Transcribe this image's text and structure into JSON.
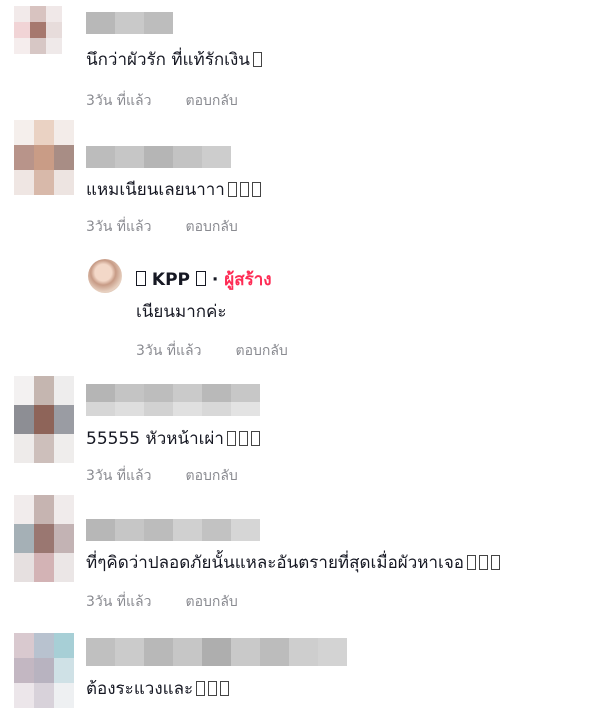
{
  "comments": [
    {
      "text": "นึกว่าผัวรัก ที่แท้รักเงิน",
      "emoji_count": 1,
      "time": "3วัน ที่แล้ว",
      "reply": "ตอบกลับ"
    },
    {
      "text": "แหมเนียนเลยนาาา",
      "emoji_count": 3,
      "time": "3วัน ที่แล้ว",
      "reply": "ตอบกลับ"
    },
    {
      "text": "55555 หัวหน้าเผ่า",
      "emoji_count": 3,
      "time": "3วัน ที่แล้ว",
      "reply": "ตอบกลับ"
    },
    {
      "text": "ที่ๆคิดว่าปลอดภัยนั้นแหละอันตรายที่สุดเมื่อผัวหาเจอ",
      "emoji_count": 3,
      "time": "3วัน ที่แล้ว",
      "reply": "ตอบกลับ"
    },
    {
      "text": "ต้องระแวงและ",
      "emoji_count": 3
    }
  ],
  "creator_reply": {
    "name": "KPP",
    "separator": "·",
    "tag": "ผู้สร้าง",
    "text": "เนียนมากค่ะ",
    "time": "3วัน ที่แล้ว",
    "reply": "ตอบกลับ"
  },
  "colors": {
    "accent": "#fe2c55",
    "meta": "#8a8b91",
    "text": "#161823"
  }
}
